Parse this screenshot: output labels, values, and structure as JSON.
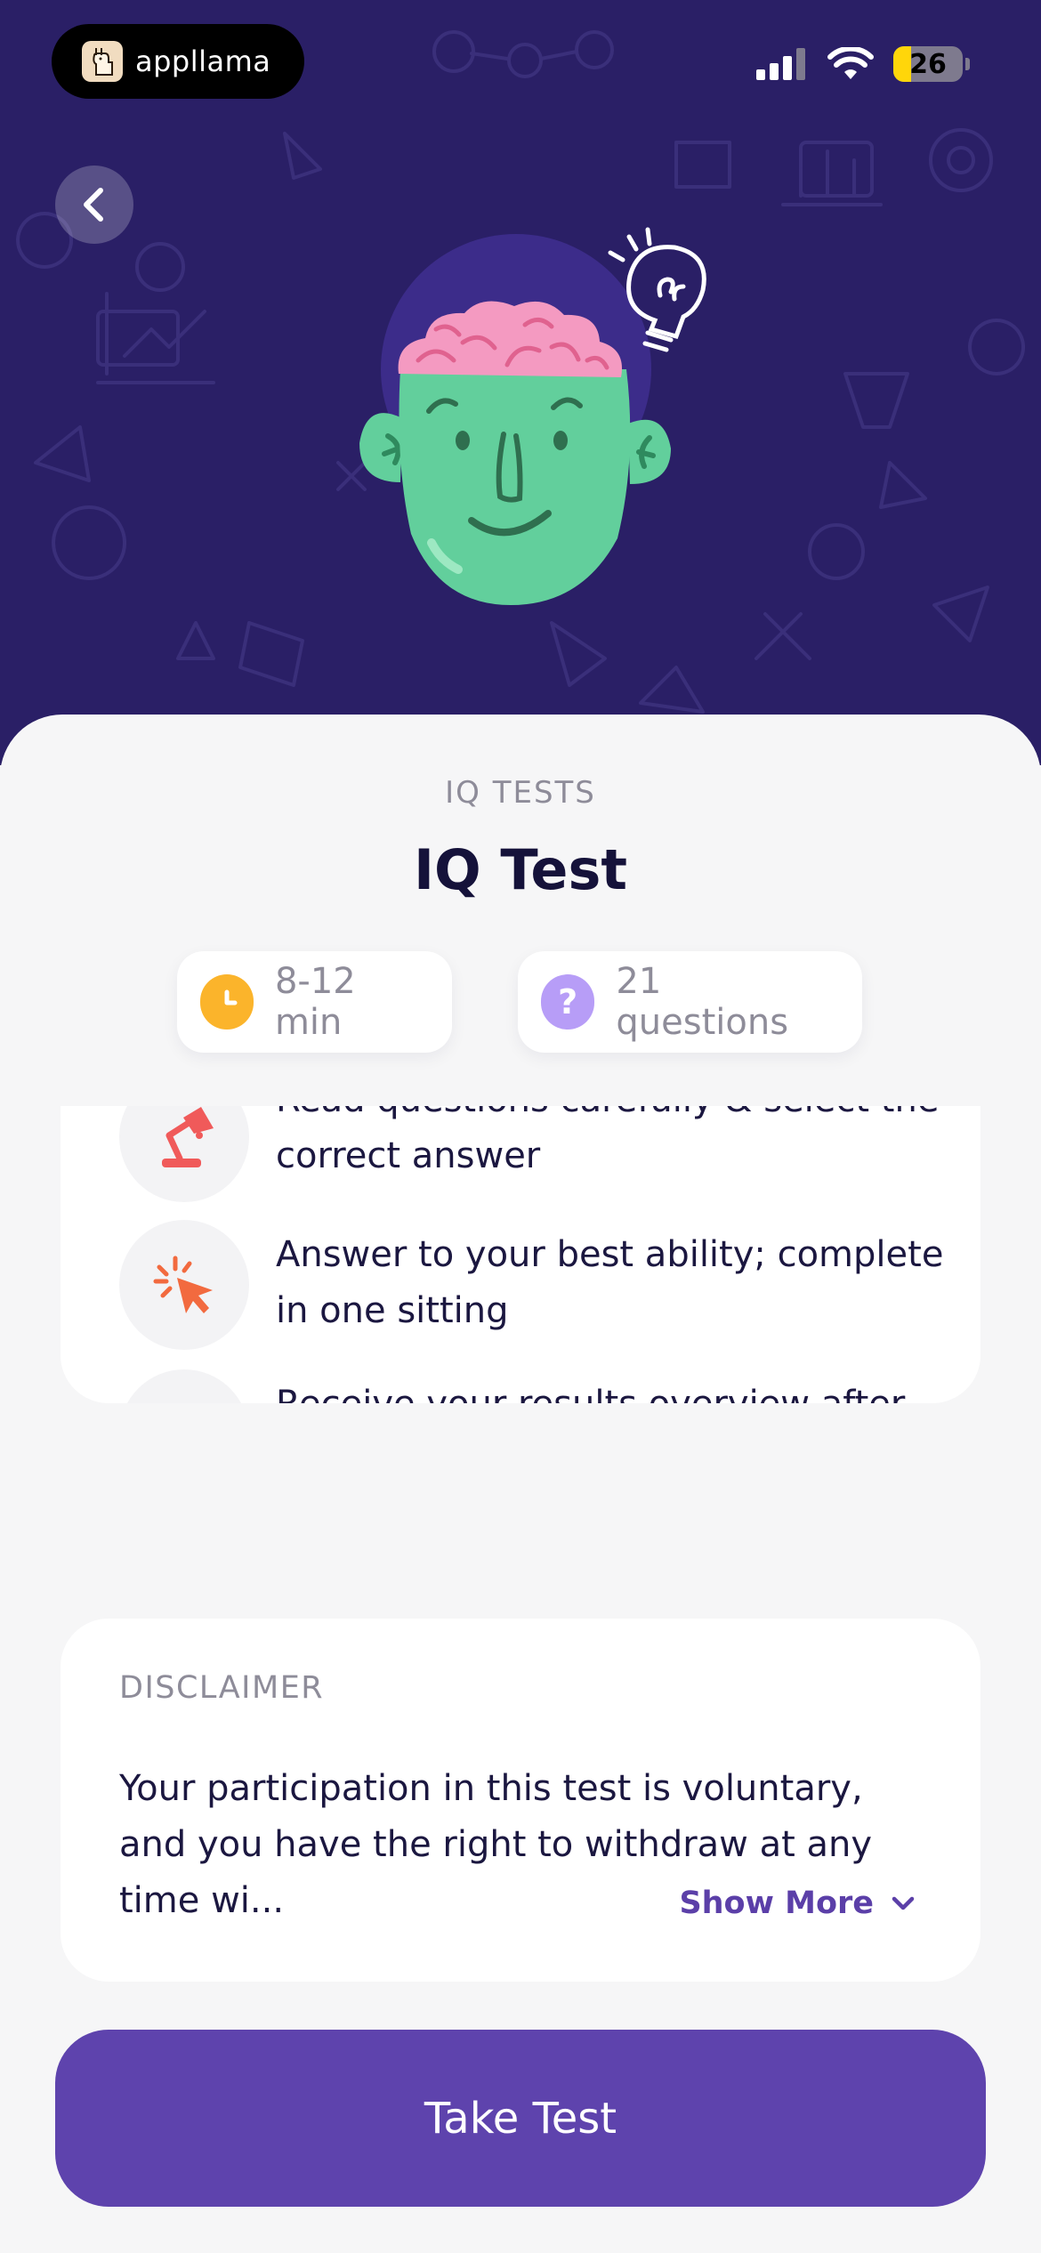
{
  "status_bar": {
    "brand": "appllama",
    "battery": "26"
  },
  "header": {
    "back_icon": "chevron-left-icon",
    "illustration": "brain-head-with-lightbulb"
  },
  "test": {
    "category": "IQ TESTS",
    "title": "IQ Test",
    "duration": "8-12 min",
    "questions": "21 questions"
  },
  "instructions": [
    {
      "icon": "desk-lamp-icon",
      "text": "Read questions carefully & select the correct answer"
    },
    {
      "icon": "cursor-click-icon",
      "text": "Answer to your best ability; complete in one sitting"
    },
    {
      "icon": "podium-star-icon",
      "text": "Receive your results overview after finishing"
    }
  ],
  "disclaimer": {
    "label": "DISCLAIMER",
    "text": "Your participation in this test is voluntary, and you have the right to withdraw at any time wi...",
    "show_more": "Show More"
  },
  "cta": {
    "label": "Take Test"
  },
  "colors": {
    "hero_bg": "#2a1f66",
    "accent": "#5e43ad",
    "clock": "#fbb42b",
    "question": "#b79df7",
    "head": "#62cf9c",
    "brain": "#f49ac1"
  }
}
